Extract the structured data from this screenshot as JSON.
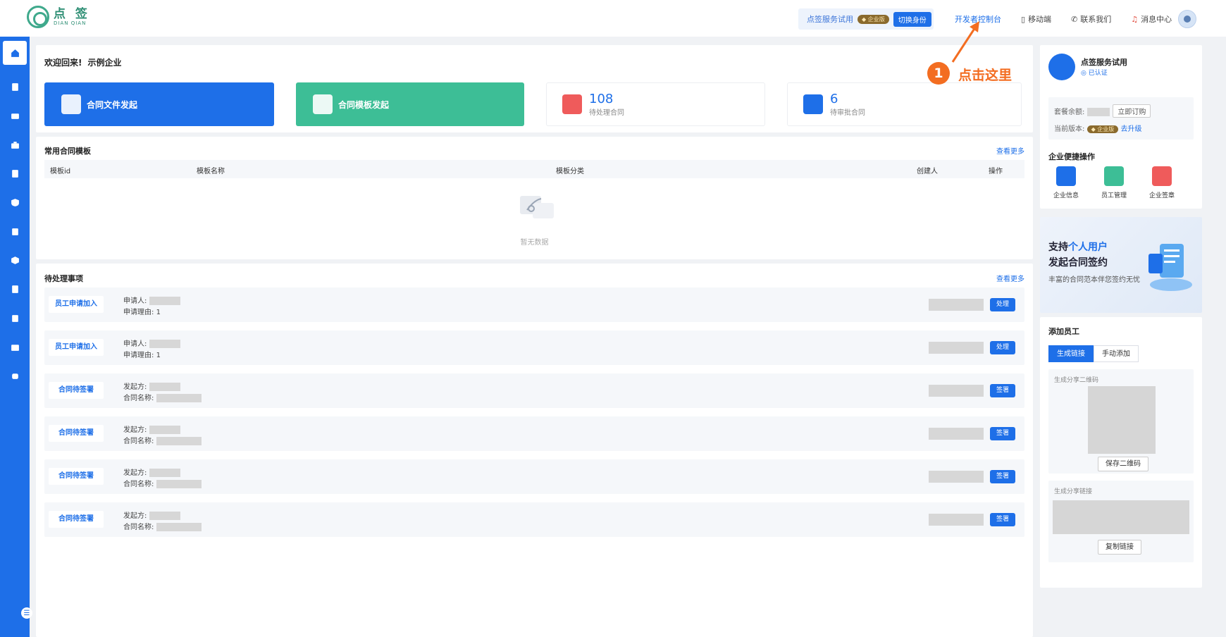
{
  "topbar": {
    "logo_cn": "点 签",
    "logo_en": "DIAN QIAN",
    "trial_label": "点签服务试用",
    "edition_badge": "企业版",
    "switch_label": "切换身份",
    "links": [
      "开发者控制台",
      "移动端",
      "联系我们",
      "消息中心"
    ]
  },
  "welcome": {
    "greeting": "欢迎回来!",
    "company": "示例企业"
  },
  "cards": {
    "file_start": "合同文件发起",
    "template_start": "合同模板发起"
  },
  "stats": [
    {
      "num": "108",
      "label": "待处理合同"
    },
    {
      "num": "6",
      "label": "待审批合同"
    }
  ],
  "templates": {
    "title": "常用合同模板",
    "more": "查看更多",
    "columns": [
      "模板id",
      "模板名称",
      "模板分类",
      "创建人",
      "操作"
    ],
    "empty": "暂无数据"
  },
  "todo": {
    "title": "待处理事项",
    "more": "查看更多",
    "rows": [
      {
        "tag": "员工申请加入",
        "k1": "申请人:",
        "k2": "申请理由:",
        "v2": "1",
        "action": "处理"
      },
      {
        "tag": "员工申请加入",
        "k1": "申请人:",
        "k2": "申请理由:",
        "v2": "1",
        "action": "处理"
      },
      {
        "tag": "合同待签署",
        "k1": "发起方:",
        "k2": "合同名称:",
        "v2": "",
        "action": "签署"
      },
      {
        "tag": "合同待签署",
        "k1": "发起方:",
        "k2": "合同名称:",
        "v2": "",
        "action": "签署"
      },
      {
        "tag": "合同待签署",
        "k1": "发起方:",
        "k2": "合同名称:",
        "v2": "",
        "action": "签署"
      },
      {
        "tag": "合同待签署",
        "k1": "发起方:",
        "k2": "合同名称:",
        "v2": "",
        "action": "签署"
      }
    ]
  },
  "org": {
    "name": "点签服务试用",
    "verified": "已认证",
    "balance_label": "套餐余额:",
    "buy": "立即订购",
    "version_label": "当前版本:",
    "badge": "企业版",
    "upgrade": "去升级"
  },
  "quick": {
    "title": "企业便捷操作",
    "items": [
      "企业信息",
      "员工管理",
      "企业签章"
    ]
  },
  "banner": {
    "line1a": "支持",
    "line1b": "个人用户",
    "line2": "发起合同签约",
    "line3": "丰富的合同范本伴您签约无忧"
  },
  "add_staff": {
    "title": "添加员工",
    "tab1": "生成链接",
    "tab2": "手动添加",
    "qr_label": "生成分享二维码",
    "save_qr": "保存二维码",
    "link_label": "生成分享链接",
    "copy_link": "复制链接"
  },
  "annotation": {
    "num": "1",
    "text": "点击这里"
  }
}
